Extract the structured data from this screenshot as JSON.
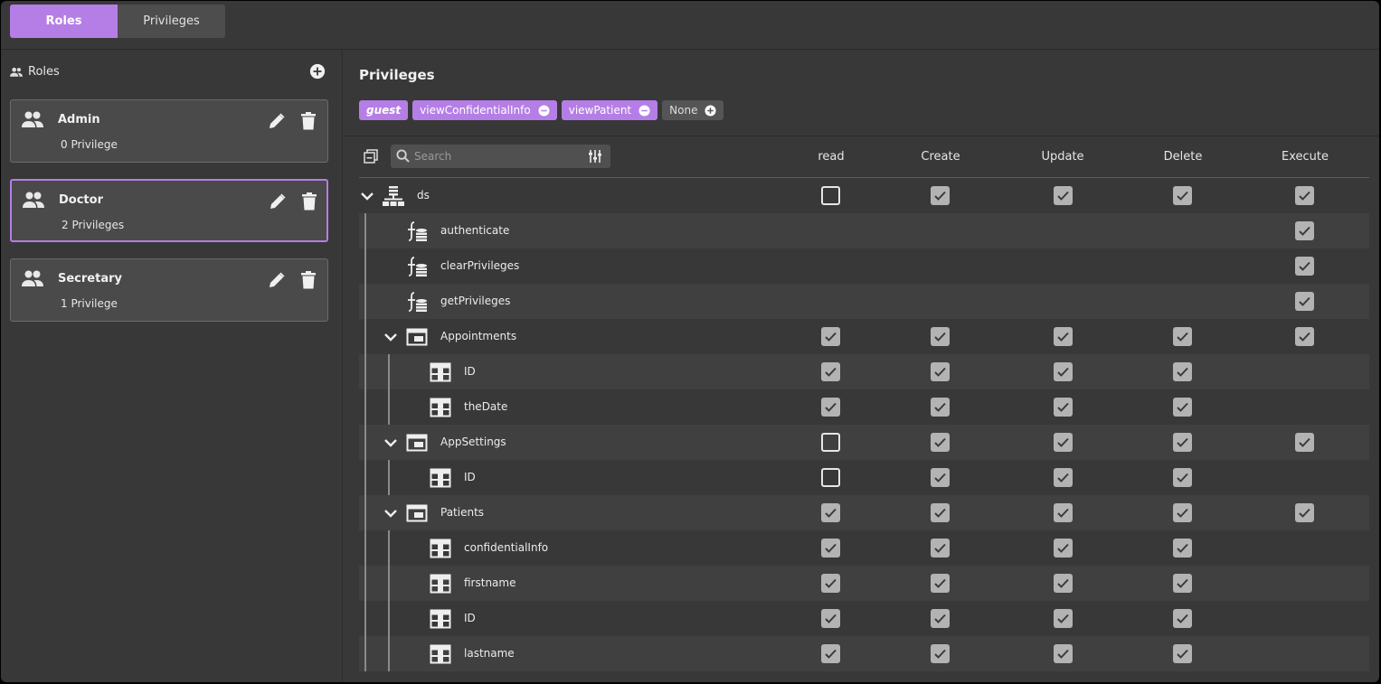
{
  "tabs": {
    "roles": "Roles",
    "privileges": "Privileges"
  },
  "roles_panel": {
    "header": "Roles",
    "roles": [
      {
        "name": "Admin",
        "count": "0 Privilege",
        "selected": false
      },
      {
        "name": "Doctor",
        "count": "2 Privileges",
        "selected": true
      },
      {
        "name": "Secretary",
        "count": "1 Privilege",
        "selected": false
      }
    ]
  },
  "privileges_panel": {
    "title": "Privileges",
    "chips": [
      {
        "label": "guest",
        "kind": "guest"
      },
      {
        "label": "viewConfidentialInfo",
        "kind": "removable"
      },
      {
        "label": "viewPatient",
        "kind": "removable"
      },
      {
        "label": "None",
        "kind": "add"
      }
    ],
    "search_placeholder": "Search",
    "columns": [
      "read",
      "Create",
      "Update",
      "Delete",
      "Execute"
    ],
    "rows": [
      {
        "label": "ds",
        "level": 0,
        "icon": "datasource-icon",
        "expandable": true,
        "perms": [
          false,
          true,
          true,
          true,
          true
        ]
      },
      {
        "label": "authenticate",
        "level": 1,
        "icon": "function-icon",
        "expandable": false,
        "perms": [
          null,
          null,
          null,
          null,
          true
        ]
      },
      {
        "label": "clearPrivileges",
        "level": 1,
        "icon": "function-icon",
        "expandable": false,
        "perms": [
          null,
          null,
          null,
          null,
          true
        ]
      },
      {
        "label": "getPrivileges",
        "level": 1,
        "icon": "function-icon",
        "expandable": false,
        "perms": [
          null,
          null,
          null,
          null,
          true
        ]
      },
      {
        "label": "Appointments",
        "level": 1,
        "icon": "table-icon",
        "expandable": true,
        "perms": [
          true,
          true,
          true,
          true,
          true
        ]
      },
      {
        "label": "ID",
        "level": 2,
        "icon": "column-icon",
        "expandable": false,
        "perms": [
          true,
          true,
          true,
          true,
          null
        ]
      },
      {
        "label": "theDate",
        "level": 2,
        "icon": "column-icon",
        "expandable": false,
        "perms": [
          true,
          true,
          true,
          true,
          null
        ]
      },
      {
        "label": "AppSettings",
        "level": 1,
        "icon": "table-icon",
        "expandable": true,
        "perms": [
          false,
          true,
          true,
          true,
          true
        ]
      },
      {
        "label": "ID",
        "level": 2,
        "icon": "column-icon",
        "expandable": false,
        "perms": [
          false,
          true,
          true,
          true,
          null
        ]
      },
      {
        "label": "Patients",
        "level": 1,
        "icon": "table-icon",
        "expandable": true,
        "perms": [
          true,
          true,
          true,
          true,
          true
        ]
      },
      {
        "label": "confidentialInfo",
        "level": 2,
        "icon": "column-icon",
        "expandable": false,
        "perms": [
          true,
          true,
          true,
          true,
          null
        ]
      },
      {
        "label": "firstname",
        "level": 2,
        "icon": "column-icon",
        "expandable": false,
        "perms": [
          true,
          true,
          true,
          true,
          null
        ]
      },
      {
        "label": "ID",
        "level": 2,
        "icon": "column-icon",
        "expandable": false,
        "perms": [
          true,
          true,
          true,
          true,
          null
        ]
      },
      {
        "label": "lastname",
        "level": 2,
        "icon": "column-icon",
        "expandable": false,
        "perms": [
          true,
          true,
          true,
          true,
          null
        ]
      }
    ]
  },
  "colors": {
    "accent": "#b57ee6",
    "panel": "#383838",
    "card": "#4a4a4a"
  }
}
